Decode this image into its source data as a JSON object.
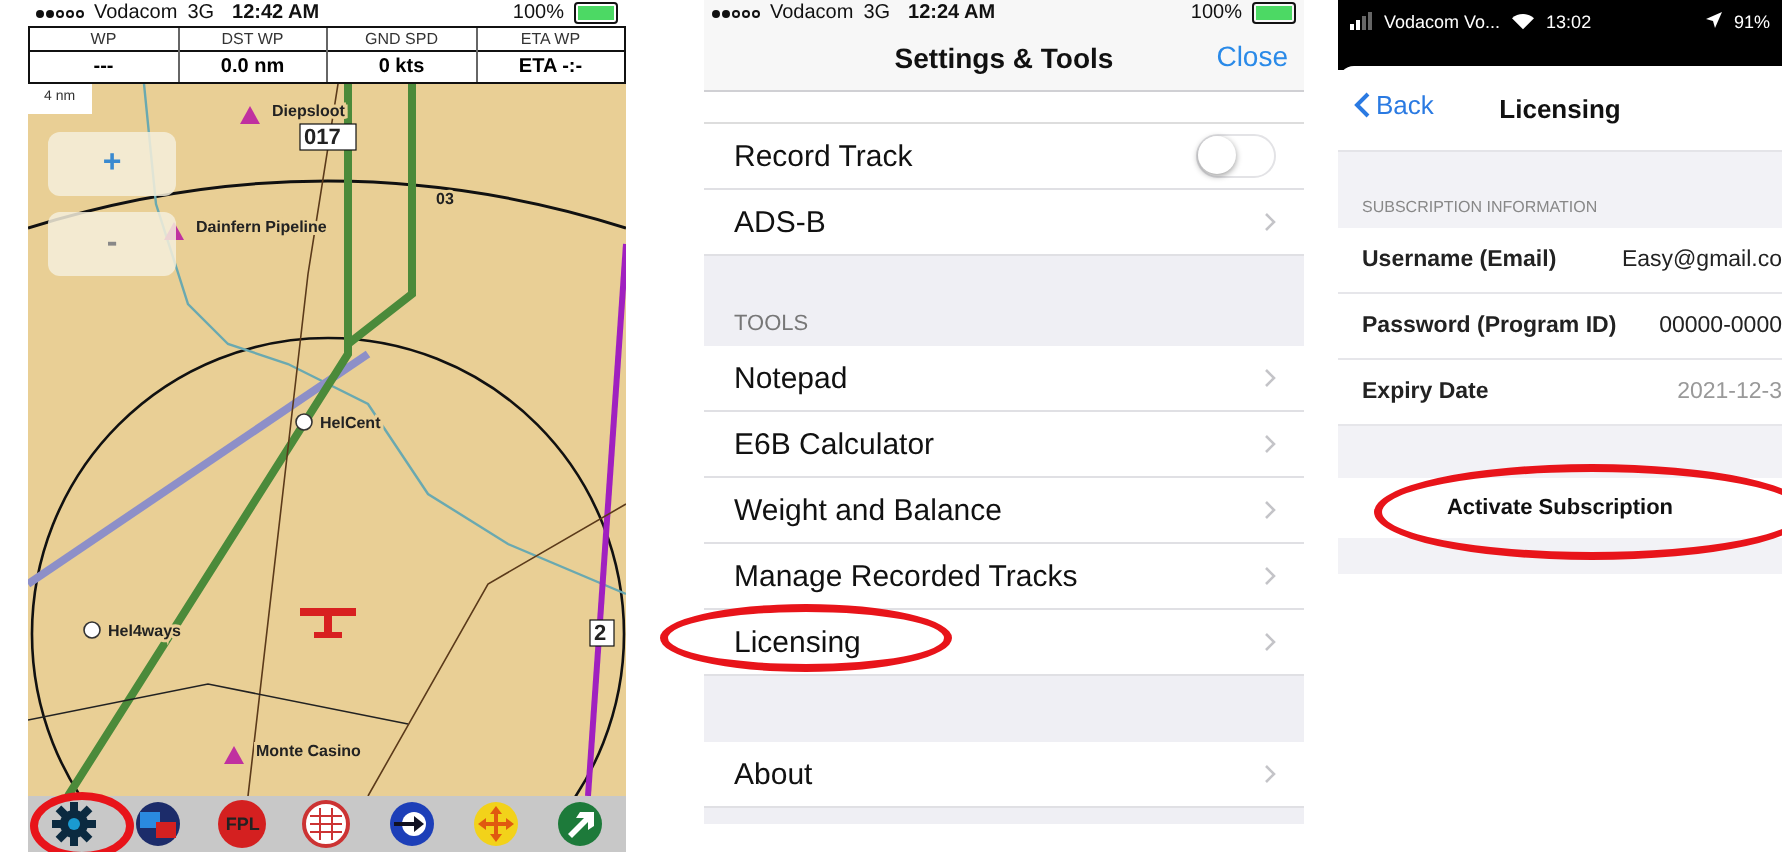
{
  "map_screen": {
    "status_bar": {
      "carrier": "Vodacom",
      "network": "3G",
      "time": "12:42 AM",
      "battery": "100%"
    },
    "nav_table": {
      "columns": [
        "WP",
        "DST WP",
        "GND SPD",
        "ETA WP"
      ],
      "values": [
        "---",
        "0.0 nm",
        "0 kts",
        "ETA -:-"
      ]
    },
    "scale": "4 nm",
    "zoom_in": "+",
    "zoom_out": "-",
    "map_labels": [
      "Diepsloot",
      "017",
      "03",
      "Dainfern Pipeline",
      "HelCent",
      "Hel4ways",
      "Monte Casino",
      "2"
    ],
    "toolbar": [
      {
        "kind": "gear",
        "circled": true
      },
      {
        "kind": "layers",
        "circled": false
      },
      {
        "kind": "fpl",
        "label": "FPL",
        "circled": false
      },
      {
        "kind": "grid",
        "circled": false
      },
      {
        "kind": "direct",
        "circled": false
      },
      {
        "kind": "pan",
        "circled": false
      },
      {
        "kind": "route",
        "circled": false
      }
    ]
  },
  "settings_screen": {
    "status_bar": {
      "carrier": "Vodacom",
      "network": "3G",
      "time": "12:24 AM",
      "battery": "100%"
    },
    "title": "Settings & Tools",
    "close": "Close",
    "groups": [
      {
        "rows": [
          {
            "kind": "toggle",
            "label": "Record Track",
            "on": false,
            "circled": false
          },
          {
            "kind": "link",
            "label": "ADS-B",
            "circled": false
          }
        ]
      },
      {
        "header": "TOOLS",
        "rows": [
          {
            "kind": "link",
            "label": "Notepad",
            "circled": false
          },
          {
            "kind": "link",
            "label": "E6B Calculator",
            "circled": false
          },
          {
            "kind": "link",
            "label": "Weight and Balance",
            "circled": false
          },
          {
            "kind": "link",
            "label": "Manage Recorded Tracks",
            "circled": false
          },
          {
            "kind": "link",
            "label": "Licensing",
            "circled": true
          }
        ]
      },
      {
        "rows": [
          {
            "kind": "link",
            "label": "About",
            "circled": false
          }
        ]
      }
    ]
  },
  "licensing_screen": {
    "status_bar": {
      "carrier": "Vodacom Vo...",
      "time": "13:02",
      "battery": "91%"
    },
    "back": "Back",
    "title": "Licensing",
    "section_header": "SUBSCRIPTION INFORMATION",
    "fields": [
      {
        "label": "Username (Email)",
        "value": "Easy@gmail.co",
        "muted": false
      },
      {
        "label": "Password (Program ID)",
        "value": "00000-0000",
        "muted": false
      },
      {
        "label": "Expiry Date",
        "value": "2021-12-3",
        "muted": true
      }
    ],
    "activate": {
      "label": "Activate Subscription",
      "circled": true
    }
  }
}
